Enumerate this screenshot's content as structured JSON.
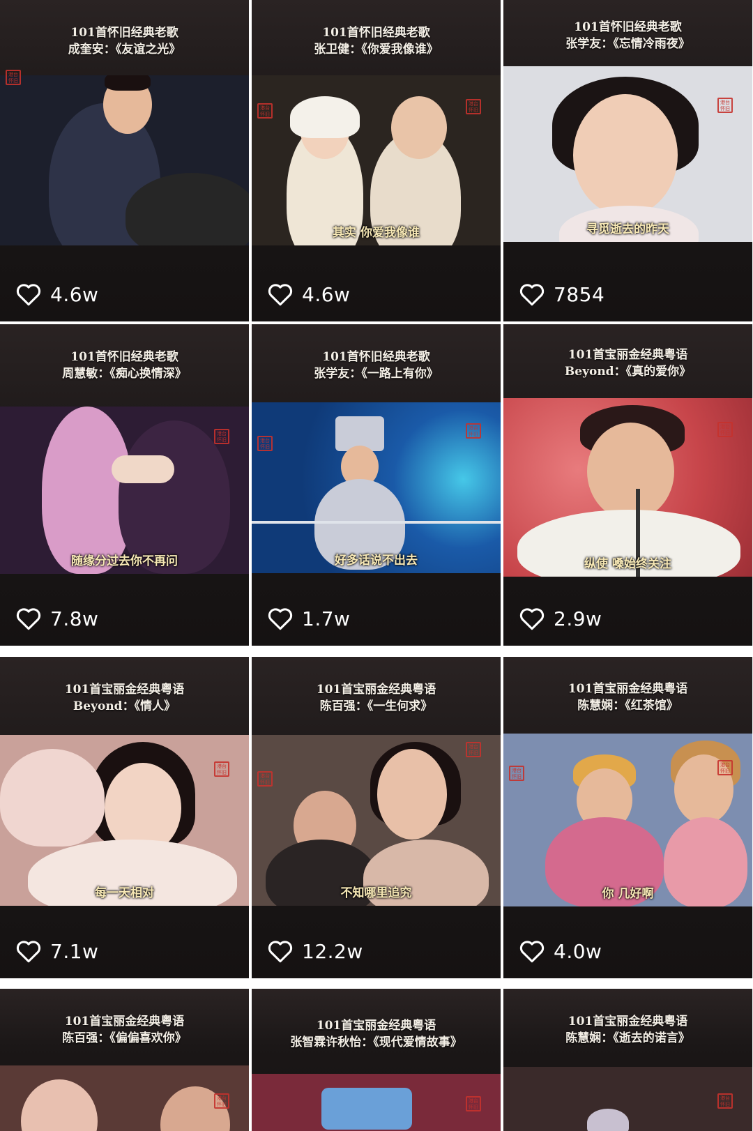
{
  "tiles": [
    {
      "header1": "101首怀旧经典老歌",
      "header2": "成奎安：《友谊之光》",
      "subtitle": "",
      "likes": "4.6w",
      "colors": {
        "photo_bg": "#1c1f2c",
        "accent": "#3a3f5a",
        "shirt": "#2e3348"
      }
    },
    {
      "header1": "101首怀旧经典老歌",
      "header2": "张卫健：《你爱我像谁》",
      "subtitle": "其实 你爱我像谁",
      "likes": "4.6w",
      "colors": {
        "photo_bg": "#2b2520",
        "accent": "#efe6d6",
        "shirt": "#e8dccb"
      }
    },
    {
      "header1": "101首怀旧经典老歌",
      "header2": "张学友：《忘情冷雨夜》",
      "subtitle": "寻觅逝去的昨天",
      "likes": "7854",
      "colors": {
        "photo_bg": "#dcdde2",
        "accent": "#1b1414",
        "shirt": "#f0e6e6"
      }
    },
    {
      "header1": "101首怀旧经典老歌",
      "header2": "周慧敏：《痴心换情深》",
      "subtitle": "随缘分过去你不再问",
      "likes": "7.8w",
      "colors": {
        "photo_bg": "#2d1c34",
        "accent": "#d99cc8",
        "shirt": "#3c2442"
      }
    },
    {
      "header1": "101首怀旧经典老歌",
      "header2": "张学友：《一路上有你》",
      "subtitle": "好多话说不出去",
      "likes": "1.7w",
      "colors": {
        "photo_bg": "#0f3a78",
        "accent": "#46c8e8",
        "shirt": "#c9ccd8"
      }
    },
    {
      "header1": "101首宝丽金经典粤语",
      "header2": "Beyond：《真的爱你》",
      "subtitle": "纵使 嗓始终关注",
      "likes": "2.9w",
      "colors": {
        "photo_bg": "#c7454a",
        "accent": "#e87b7d",
        "shirt": "#f2f0ea"
      }
    },
    {
      "header1": "101首宝丽金经典粤语",
      "header2": "Beyond：《情人》",
      "subtitle": "每一天相对",
      "likes": "7.1w",
      "colors": {
        "photo_bg": "#c9a19a",
        "accent": "#f0d6d0",
        "shirt": "#f4e6e0"
      }
    },
    {
      "header1": "101首宝丽金经典粤语",
      "header2": "陈百强：《一生何求》",
      "subtitle": "不知哪里追究",
      "likes": "12.2w",
      "colors": {
        "photo_bg": "#5a4a44",
        "accent": "#d8b8a8",
        "shirt": "#2a2424"
      }
    },
    {
      "header1": "101首宝丽金经典粤语",
      "header2": "陈慧娴：《红茶馆》",
      "subtitle": "你 几好啊",
      "likes": "4.0w",
      "colors": {
        "photo_bg": "#7d8eb0",
        "accent": "#e2a84a",
        "shirt": "#d46a8e"
      }
    },
    {
      "header1": "101首宝丽金经典粤语",
      "header2": "陈百强：《偏偏喜欢你》",
      "subtitle": "",
      "likes": "",
      "colors": {
        "photo_bg": "#5a3a36",
        "accent": "#e8c0b0",
        "shirt": "#3a2a28"
      }
    },
    {
      "header1": "101首宝丽金经典粤语",
      "header2": "张智霖许秋怡：《现代爱情故事》",
      "subtitle": "",
      "likes": "",
      "colors": {
        "photo_bg": "#7a2a3a",
        "accent": "#6aa0d8",
        "shirt": "#2a2a3a"
      }
    },
    {
      "header1": "101首宝丽金经典粤语",
      "header2": "陈慧娴：《逝去的诺言》",
      "subtitle": "",
      "likes": "",
      "colors": {
        "photo_bg": "#3a2a2a",
        "accent": "#c8c0d0",
        "shirt": "#2a2222"
      }
    }
  ],
  "icons": {
    "like": "heart-outline-icon",
    "seal": "chinese-seal-stamp"
  },
  "seal_text": "港台\n怀旧"
}
